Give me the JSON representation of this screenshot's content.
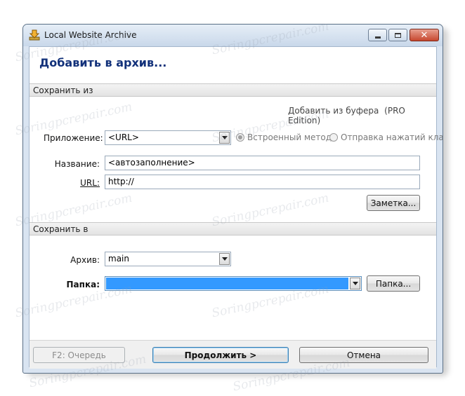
{
  "window": {
    "title": "Local Website Archive",
    "controls": {
      "minimize_icon": "minimize-icon",
      "maximize_icon": "maximize-icon",
      "close_icon": "close-icon",
      "close_glyph": "✕"
    }
  },
  "header": {
    "title": "Добавить в архив..."
  },
  "section_from": {
    "title": "Сохранить из",
    "clipboard_link": "Добавить из буфера",
    "clipboard_edition": "(PRO Edition)",
    "application_label": "Приложение:",
    "application_value": "<URL>",
    "method_builtin": "Встроенный метод",
    "method_keystrokes": "Отправка нажатий клави",
    "name_label": "Название:",
    "name_value": "<автозаполнение>",
    "url_label": "URL:",
    "url_value": "http://",
    "note_button": "Заметка..."
  },
  "section_to": {
    "title": "Сохранить в",
    "archive_label": "Архив:",
    "archive_value": "main",
    "folder_label": "Папка:",
    "folder_value": "",
    "folder_button": "Папка..."
  },
  "footer": {
    "queue_button": "F2: Очередь",
    "continue_button": "Продолжить >",
    "cancel_button": "Отмена"
  },
  "watermark": "Soringpcrepair.com",
  "colors": {
    "title": "#12317a",
    "selection": "#3399ff",
    "accent_border": "#3c7fb1"
  }
}
